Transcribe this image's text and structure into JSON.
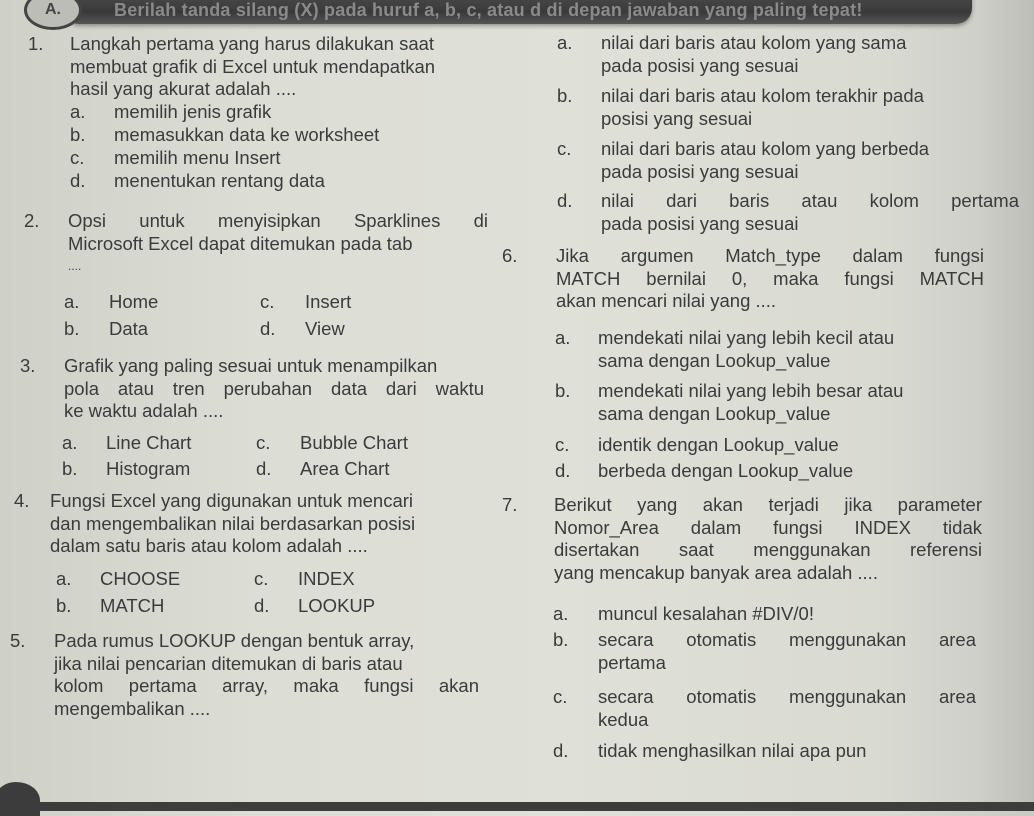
{
  "header": {
    "section_label": "A.",
    "instruction": "Berilah tanda silang (X) pada huruf a, b, c, atau d di depan jawaban yang paling tepat!"
  },
  "questions": [
    {
      "number": "1.",
      "lines": [
        "Langkah pertama yang harus dilakukan saat",
        "membuat grafik di Excel untuk mendapatkan",
        "hasil yang akurat adalah ...."
      ],
      "options": [
        {
          "letter": "a.",
          "text": "memilih jenis grafik"
        },
        {
          "letter": "b.",
          "text": "memasukkan data ke worksheet"
        },
        {
          "letter": "c.",
          "text": "memilih menu Insert"
        },
        {
          "letter": "d.",
          "text": "menentukan rentang data"
        }
      ]
    },
    {
      "number": "2.",
      "lines": [
        "Opsi untuk menyisipkan Sparklines di",
        "Microsoft Excel dapat ditemukan pada tab",
        "...."
      ],
      "options": [
        {
          "letter": "a.",
          "text": "Home"
        },
        {
          "letter": "b.",
          "text": "Data"
        },
        {
          "letter": "c.",
          "text": "Insert"
        },
        {
          "letter": "d.",
          "text": "View"
        }
      ]
    },
    {
      "number": "3.",
      "lines": [
        "Grafik yang paling sesuai untuk menampilkan",
        "pola atau tren perubahan data dari waktu",
        "ke waktu adalah ...."
      ],
      "options": [
        {
          "letter": "a.",
          "text": "Line Chart"
        },
        {
          "letter": "b.",
          "text": "Histogram"
        },
        {
          "letter": "c.",
          "text": "Bubble Chart"
        },
        {
          "letter": "d.",
          "text": "Area Chart"
        }
      ]
    },
    {
      "number": "4.",
      "lines": [
        "Fungsi Excel yang digunakan untuk mencari",
        "dan mengembalikan nilai berdasarkan posisi",
        "dalam satu baris atau kolom adalah ...."
      ],
      "options": [
        {
          "letter": "a.",
          "text": "CHOOSE"
        },
        {
          "letter": "b.",
          "text": "MATCH"
        },
        {
          "letter": "c.",
          "text": "INDEX"
        },
        {
          "letter": "d.",
          "text": "LOOKUP"
        }
      ]
    },
    {
      "number": "5.",
      "lines": [
        "Pada rumus LOOKUP dengan bentuk array,",
        "jika nilai pencarian ditemukan di baris atau",
        "kolom pertama array, maka fungsi akan",
        "mengembalikan ...."
      ],
      "options": [
        {
          "letter": "a.",
          "lines": [
            "nilai dari baris atau kolom yang sama",
            "pada posisi yang sesuai"
          ]
        },
        {
          "letter": "b.",
          "lines": [
            "nilai dari baris atau kolom terakhir pada",
            "posisi yang sesuai"
          ]
        },
        {
          "letter": "c.",
          "lines": [
            "nilai dari baris atau kolom yang berbeda",
            "pada posisi yang sesuai"
          ]
        },
        {
          "letter": "d.",
          "lines": [
            "nilai dari baris atau kolom pertama",
            "pada posisi yang sesuai"
          ]
        }
      ]
    },
    {
      "number": "6.",
      "lines": [
        "Jika argumen Match_type dalam fungsi",
        "MATCH bernilai 0, maka fungsi MATCH",
        "akan mencari nilai yang ...."
      ],
      "options": [
        {
          "letter": "a.",
          "lines": [
            "mendekati nilai yang lebih kecil atau",
            "sama dengan Lookup_value"
          ]
        },
        {
          "letter": "b.",
          "lines": [
            "mendekati nilai yang lebih besar atau",
            "sama dengan Lookup_value"
          ]
        },
        {
          "letter": "c.",
          "lines": [
            "identik dengan Lookup_value"
          ]
        },
        {
          "letter": "d.",
          "lines": [
            "berbeda dengan Lookup_value"
          ]
        }
      ]
    },
    {
      "number": "7.",
      "lines": [
        "Berikut yang akan terjadi jika parameter",
        "Nomor_Area dalam fungsi INDEX tidak",
        "disertakan saat menggunakan referensi",
        "yang mencakup banyak area adalah ...."
      ],
      "options": [
        {
          "letter": "a.",
          "lines": [
            "muncul kesalahan #DIV/0!"
          ]
        },
        {
          "letter": "b.",
          "lines": [
            "secara otomatis menggunakan area",
            "pertama"
          ]
        },
        {
          "letter": "c.",
          "lines": [
            "secara otomatis menggunakan area",
            "kedua"
          ]
        },
        {
          "letter": "d.",
          "lines": [
            "tidak menghasilkan nilai apa pun"
          ]
        }
      ]
    }
  ]
}
